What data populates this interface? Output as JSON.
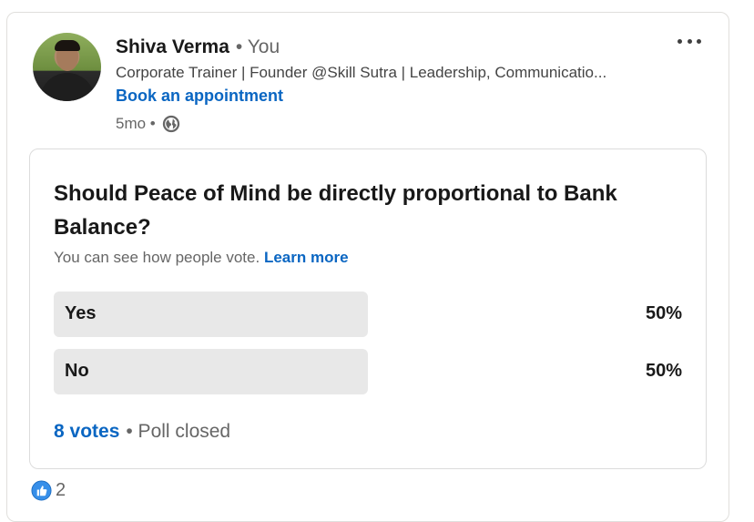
{
  "author": {
    "name": "Shiva Verma",
    "relation": "• You",
    "headline": "Corporate Trainer | Founder @Skill Sutra | Leadership, Communicatio...",
    "cta": "Book an appointment",
    "age": "5mo •",
    "visibility_icon": "globe-icon"
  },
  "menu_icon": "more-horizontal-icon",
  "poll": {
    "question": "Should Peace of Mind be directly proportional to Bank Balance?",
    "visibility_note": "You can see how people vote.",
    "learn_more": "Learn more",
    "options": [
      {
        "label": "Yes",
        "percent_label": "50%",
        "share": 0.5
      },
      {
        "label": "No",
        "percent_label": "50%",
        "share": 0.5
      }
    ],
    "votes": "8 votes",
    "status": "• Poll closed"
  },
  "reactions": {
    "icon": "like-icon",
    "count": "2"
  },
  "colors": {
    "link": "#0a66c2",
    "bar": "#e8e8e8",
    "like_blue": "#378fe9"
  }
}
